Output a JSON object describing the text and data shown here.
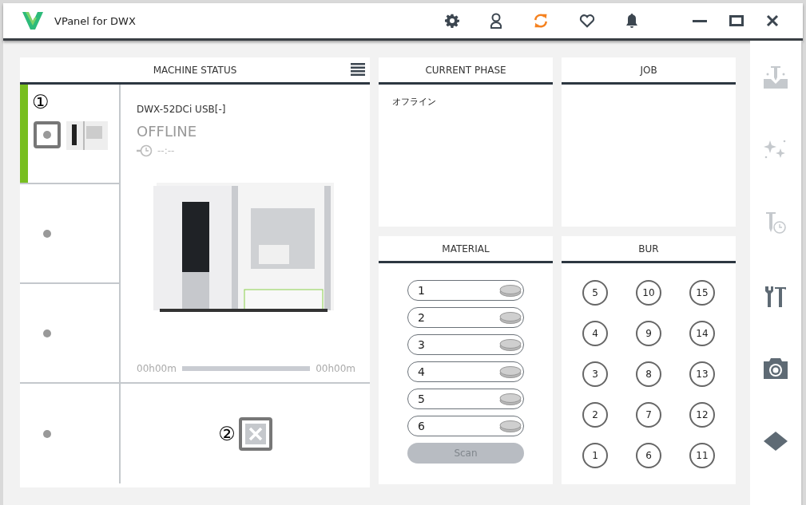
{
  "window": {
    "title": "VPanel for DWX"
  },
  "machine_status": {
    "title": "MACHINE STATUS",
    "slots": [
      {
        "kind": "machine",
        "selected": true
      },
      {
        "kind": "empty",
        "selected": false
      },
      {
        "kind": "empty",
        "selected": false
      },
      {
        "kind": "empty",
        "selected": false
      }
    ],
    "callouts": [
      "①",
      "②"
    ],
    "machine": {
      "name": "DWX-52DCi USB[-]",
      "status": "OFFLINE",
      "time": "--:--",
      "elapsed": "00h00m",
      "remaining": "00h00m",
      "level": 0
    }
  },
  "current_phase": {
    "title": "CURRENT PHASE",
    "text": "オフライン"
  },
  "job": {
    "title": "JOB"
  },
  "material": {
    "title": "MATERIAL",
    "slots": [
      "1",
      "2",
      "3",
      "4",
      "5",
      "6"
    ],
    "scan_button": {
      "label": "Scan",
      "disabled": true
    }
  },
  "bur": {
    "title": "BUR",
    "rows": [
      [
        "5",
        "10",
        "15"
      ],
      [
        "4",
        "9",
        "14"
      ],
      [
        "3",
        "8",
        "13"
      ],
      [
        "2",
        "7",
        "12"
      ],
      [
        "1",
        "6",
        "11"
      ]
    ]
  },
  "sidebar": [
    {
      "kind": "mill",
      "disabled": true
    },
    {
      "kind": "sparkle",
      "disabled": true
    },
    {
      "kind": "bur-time",
      "disabled": true
    },
    {
      "kind": "tools",
      "disabled": false
    },
    {
      "kind": "camera",
      "disabled": false
    },
    {
      "kind": "diamond",
      "disabled": false
    }
  ]
}
